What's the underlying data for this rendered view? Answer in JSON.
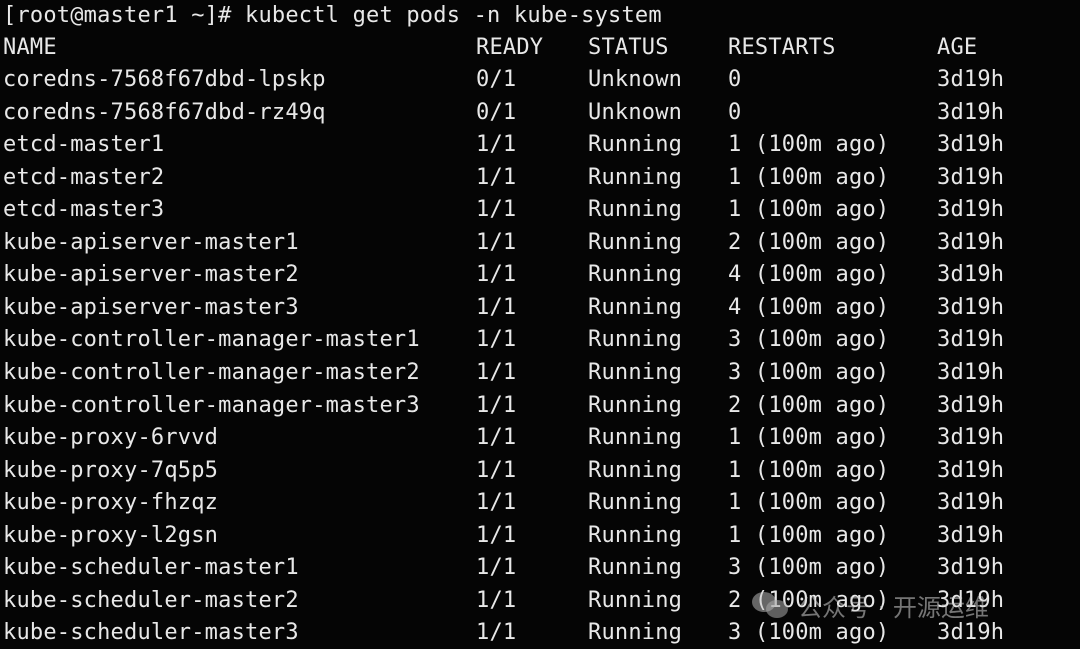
{
  "terminal": {
    "prompt": "[root@master1 ~]# kubectl get pods -n kube-system",
    "headers": {
      "name": "NAME",
      "ready": "READY",
      "status": "STATUS",
      "restarts": "RESTARTS",
      "age": "AGE"
    },
    "rows": [
      {
        "name": "coredns-7568f67dbd-lpskp",
        "ready": "0/1",
        "status": "Unknown",
        "restarts": "0",
        "age": "3d19h"
      },
      {
        "name": "coredns-7568f67dbd-rz49q",
        "ready": "0/1",
        "status": "Unknown",
        "restarts": "0",
        "age": "3d19h"
      },
      {
        "name": "etcd-master1",
        "ready": "1/1",
        "status": "Running",
        "restarts": "1 (100m ago)",
        "age": "3d19h"
      },
      {
        "name": "etcd-master2",
        "ready": "1/1",
        "status": "Running",
        "restarts": "1 (100m ago)",
        "age": "3d19h"
      },
      {
        "name": "etcd-master3",
        "ready": "1/1",
        "status": "Running",
        "restarts": "1 (100m ago)",
        "age": "3d19h"
      },
      {
        "name": "kube-apiserver-master1",
        "ready": "1/1",
        "status": "Running",
        "restarts": "2 (100m ago)",
        "age": "3d19h"
      },
      {
        "name": "kube-apiserver-master2",
        "ready": "1/1",
        "status": "Running",
        "restarts": "4 (100m ago)",
        "age": "3d19h"
      },
      {
        "name": "kube-apiserver-master3",
        "ready": "1/1",
        "status": "Running",
        "restarts": "4 (100m ago)",
        "age": "3d19h"
      },
      {
        "name": "kube-controller-manager-master1",
        "ready": "1/1",
        "status": "Running",
        "restarts": "3 (100m ago)",
        "age": "3d19h"
      },
      {
        "name": "kube-controller-manager-master2",
        "ready": "1/1",
        "status": "Running",
        "restarts": "3 (100m ago)",
        "age": "3d19h"
      },
      {
        "name": "kube-controller-manager-master3",
        "ready": "1/1",
        "status": "Running",
        "restarts": "2 (100m ago)",
        "age": "3d19h"
      },
      {
        "name": "kube-proxy-6rvvd",
        "ready": "1/1",
        "status": "Running",
        "restarts": "1 (100m ago)",
        "age": "3d19h"
      },
      {
        "name": "kube-proxy-7q5p5",
        "ready": "1/1",
        "status": "Running",
        "restarts": "1 (100m ago)",
        "age": "3d19h"
      },
      {
        "name": "kube-proxy-fhzqz",
        "ready": "1/1",
        "status": "Running",
        "restarts": "1 (100m ago)",
        "age": "3d19h"
      },
      {
        "name": "kube-proxy-l2gsn",
        "ready": "1/1",
        "status": "Running",
        "restarts": "1 (100m ago)",
        "age": "3d19h"
      },
      {
        "name": "kube-scheduler-master1",
        "ready": "1/1",
        "status": "Running",
        "restarts": "3 (100m ago)",
        "age": "3d19h"
      },
      {
        "name": "kube-scheduler-master2",
        "ready": "1/1",
        "status": "Running",
        "restarts": "2 (100m ago)",
        "age": "3d19h"
      },
      {
        "name": "kube-scheduler-master3",
        "ready": "1/1",
        "status": "Running",
        "restarts": "3 (100m ago)",
        "age": "3d19h"
      }
    ]
  },
  "watermark": {
    "icon": "wechat-icon",
    "text": "公众号 · 开源运维"
  },
  "colors": {
    "background": "#050505",
    "text": "#e8e8e8"
  }
}
